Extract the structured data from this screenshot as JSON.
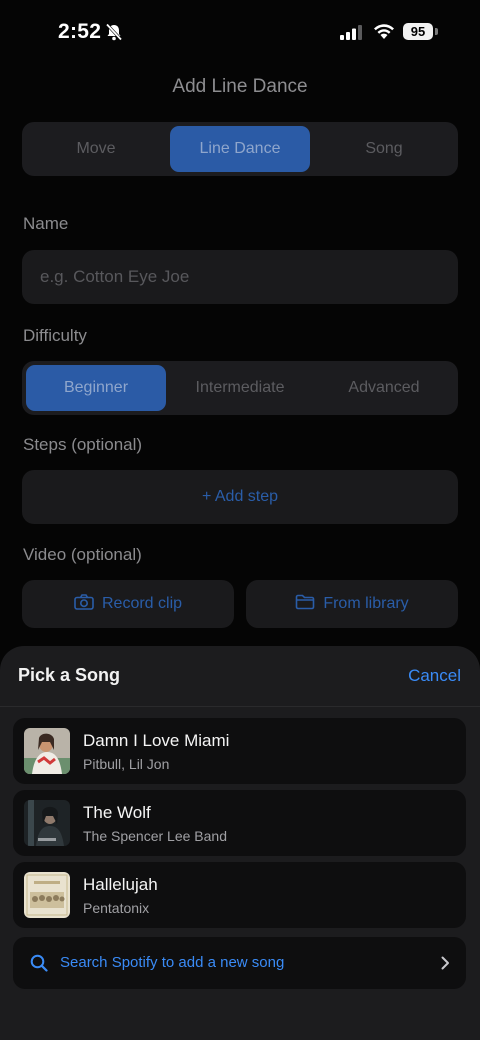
{
  "status": {
    "time": "2:52",
    "battery": "95"
  },
  "page": {
    "title": "Add Line Dance",
    "type_tabs": [
      "Move",
      "Line Dance",
      "Song"
    ],
    "name_label": "Name",
    "name_placeholder": "e.g. Cotton Eye Joe",
    "difficulty_label": "Difficulty",
    "difficulty_options": [
      "Beginner",
      "Intermediate",
      "Advanced"
    ],
    "steps_label": "Steps (optional)",
    "add_step": "+ Add step",
    "video_label": "Video (optional)",
    "record_clip": "Record clip",
    "from_library": "From library"
  },
  "sheet": {
    "title": "Pick a Song",
    "cancel": "Cancel",
    "songs": [
      {
        "title": "Damn I Love Miami",
        "artist": "Pitbull, Lil Jon"
      },
      {
        "title": "The Wolf",
        "artist": "The Spencer Lee Band"
      },
      {
        "title": "Hallelujah",
        "artist": "Pentatonix"
      }
    ],
    "search_spotify": "Search Spotify to add a new song"
  },
  "colors": {
    "accent": "#3a8bf6",
    "active_segment": "#2b5ba6",
    "sheet_bg": "#1c1c1e"
  }
}
